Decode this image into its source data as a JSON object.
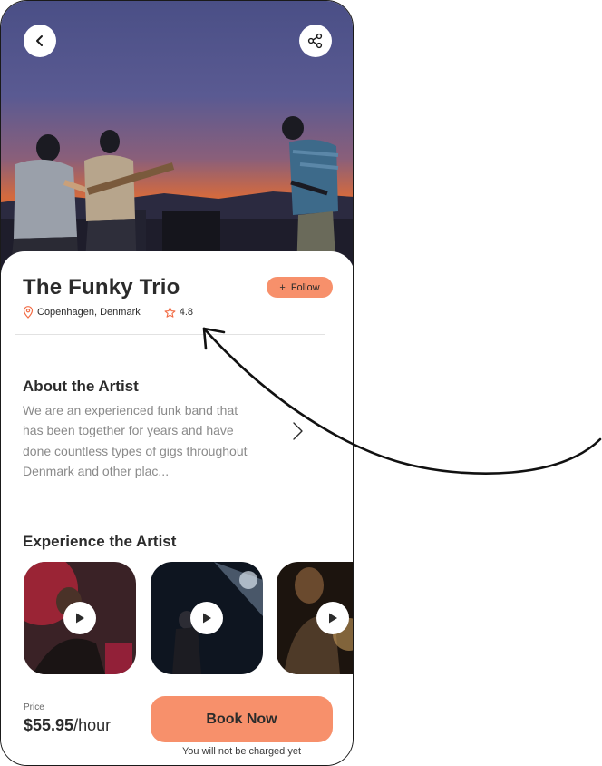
{
  "artist": {
    "name": "The Funky Trio",
    "location": "Copenhagen, Denmark",
    "rating": "4.8"
  },
  "actions": {
    "follow_label": "Follow",
    "follow_prefix": "+"
  },
  "about": {
    "heading": "About the Artist",
    "text": "We are an experienced funk band that has been together for years and have done countless types of gigs throughout Denmark and other plac..."
  },
  "experience": {
    "heading": "Experience the Artist",
    "videos": [
      "video-1",
      "video-2",
      "video-3"
    ]
  },
  "booking": {
    "price_label": "Price",
    "price_amount": "$55.95",
    "price_unit": "/hour",
    "book_label": "Book Now",
    "charge_note": "You will not be charged yet"
  },
  "colors": {
    "accent": "#f7906b",
    "text": "#2b2b2b",
    "muted": "#8a8a8a"
  },
  "icons": {
    "back": "chevron-left-icon",
    "share": "share-icon",
    "location": "map-pin-icon",
    "rating": "star-icon",
    "play": "play-icon",
    "more": "chevron-right-icon"
  }
}
